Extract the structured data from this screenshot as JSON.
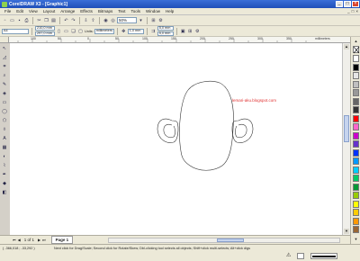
{
  "window": {
    "title": "CorelDRAW X3 - [Graphic1]",
    "title_red": "",
    "min": "_",
    "max": "□",
    "close": "×"
  },
  "menu": [
    "File",
    "Edit",
    "View",
    "Layout",
    "Arrange",
    "Effects",
    "Bitmaps",
    "Text",
    "Tools",
    "Window",
    "Help"
  ],
  "toolbar": {
    "zoom": "50%"
  },
  "propbar": {
    "paper": "A4",
    "width": "210,0 mm",
    "height": "297,0 mm",
    "units_label": "Units:",
    "units": "millimeters",
    "nudge": "1,0 mm",
    "dup_x": "5,0 mm",
    "dup_y": "5,0 mm"
  },
  "ruler": {
    "h_labels": [
      "100",
      "50",
      "0",
      "50",
      "100",
      "150",
      "200",
      "250",
      "300",
      "350",
      "millimeters"
    ],
    "v_labels": [
      "200",
      "150",
      "100",
      "50",
      "0"
    ]
  },
  "canvas": {
    "watermark": "lemari-aku.blogspot.com"
  },
  "page_nav": {
    "counter": "1 of 1",
    "page_tab": "Page 1"
  },
  "status": {
    "coords": "( -366,018 ; -33,292 )",
    "hint": "Next click for Drag/Scale; Second click for Rotate/Skew; Dbl-clicking tool selects all objects; Shift+click multi-selects; Alt+click digs"
  },
  "palette": {
    "colors": [
      "#ffffff",
      "#000000",
      "#e6e6e6",
      "#c0c0c0",
      "#999999",
      "#666666",
      "#333333",
      "#ff0000",
      "#ff66cc",
      "#cc00cc",
      "#6633cc",
      "#0033ff",
      "#0099ff",
      "#00ccff",
      "#00cc66",
      "#009933",
      "#99cc00",
      "#ffff00",
      "#ffcc00",
      "#ff9900",
      "#996633"
    ]
  }
}
